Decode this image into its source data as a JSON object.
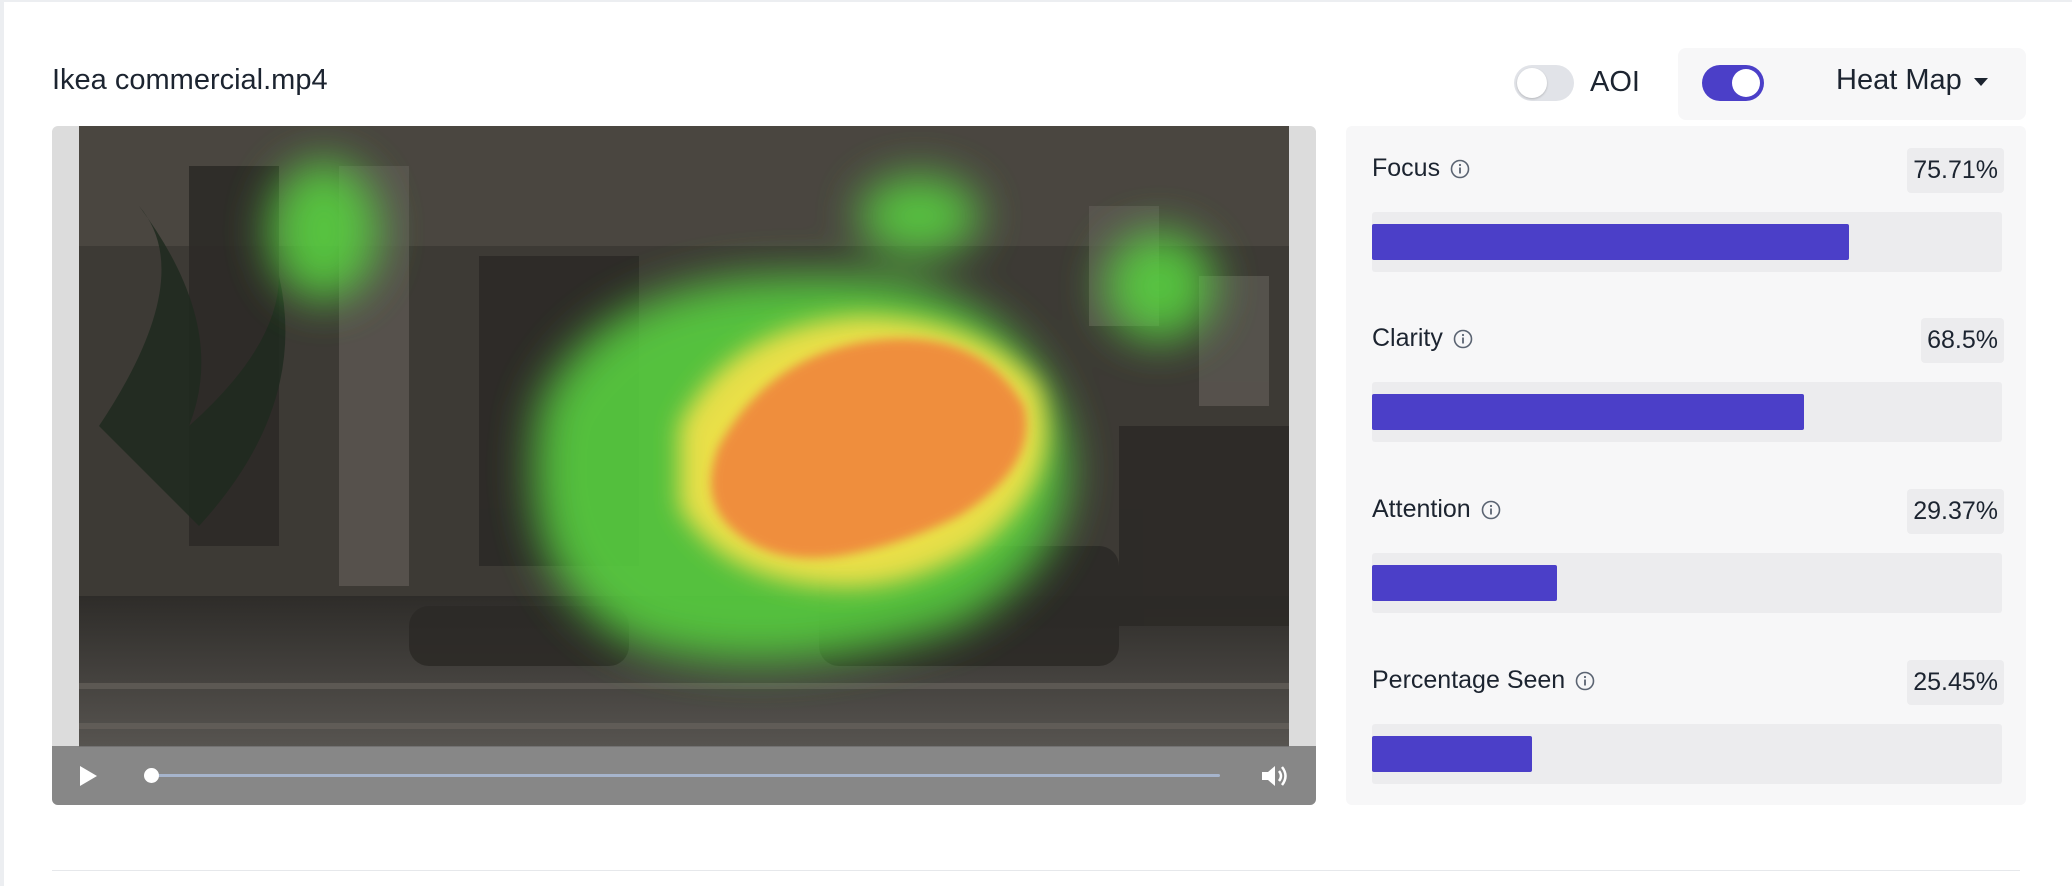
{
  "title": "Ikea commercial.mp4",
  "toggles": {
    "aoi": {
      "label": "AOI",
      "on": false
    },
    "heatmap": {
      "on": true,
      "selected": "Heat Map"
    }
  },
  "metrics": [
    {
      "label": "Focus",
      "value": "75.71%",
      "fraction": 0.7571
    },
    {
      "label": "Clarity",
      "value": "68.5%",
      "fraction": 0.685
    },
    {
      "label": "Attention",
      "value": "29.37%",
      "fraction": 0.2937
    },
    {
      "label": "Percentage Seen",
      "value": "25.45%",
      "fraction": 0.2545
    }
  ],
  "player": {
    "progress": 0.0
  },
  "colors": {
    "accent": "#4b3fc8",
    "heat_hot": "#f08a3c",
    "heat_mid": "#f1e14a",
    "heat_cool": "#58d040"
  }
}
